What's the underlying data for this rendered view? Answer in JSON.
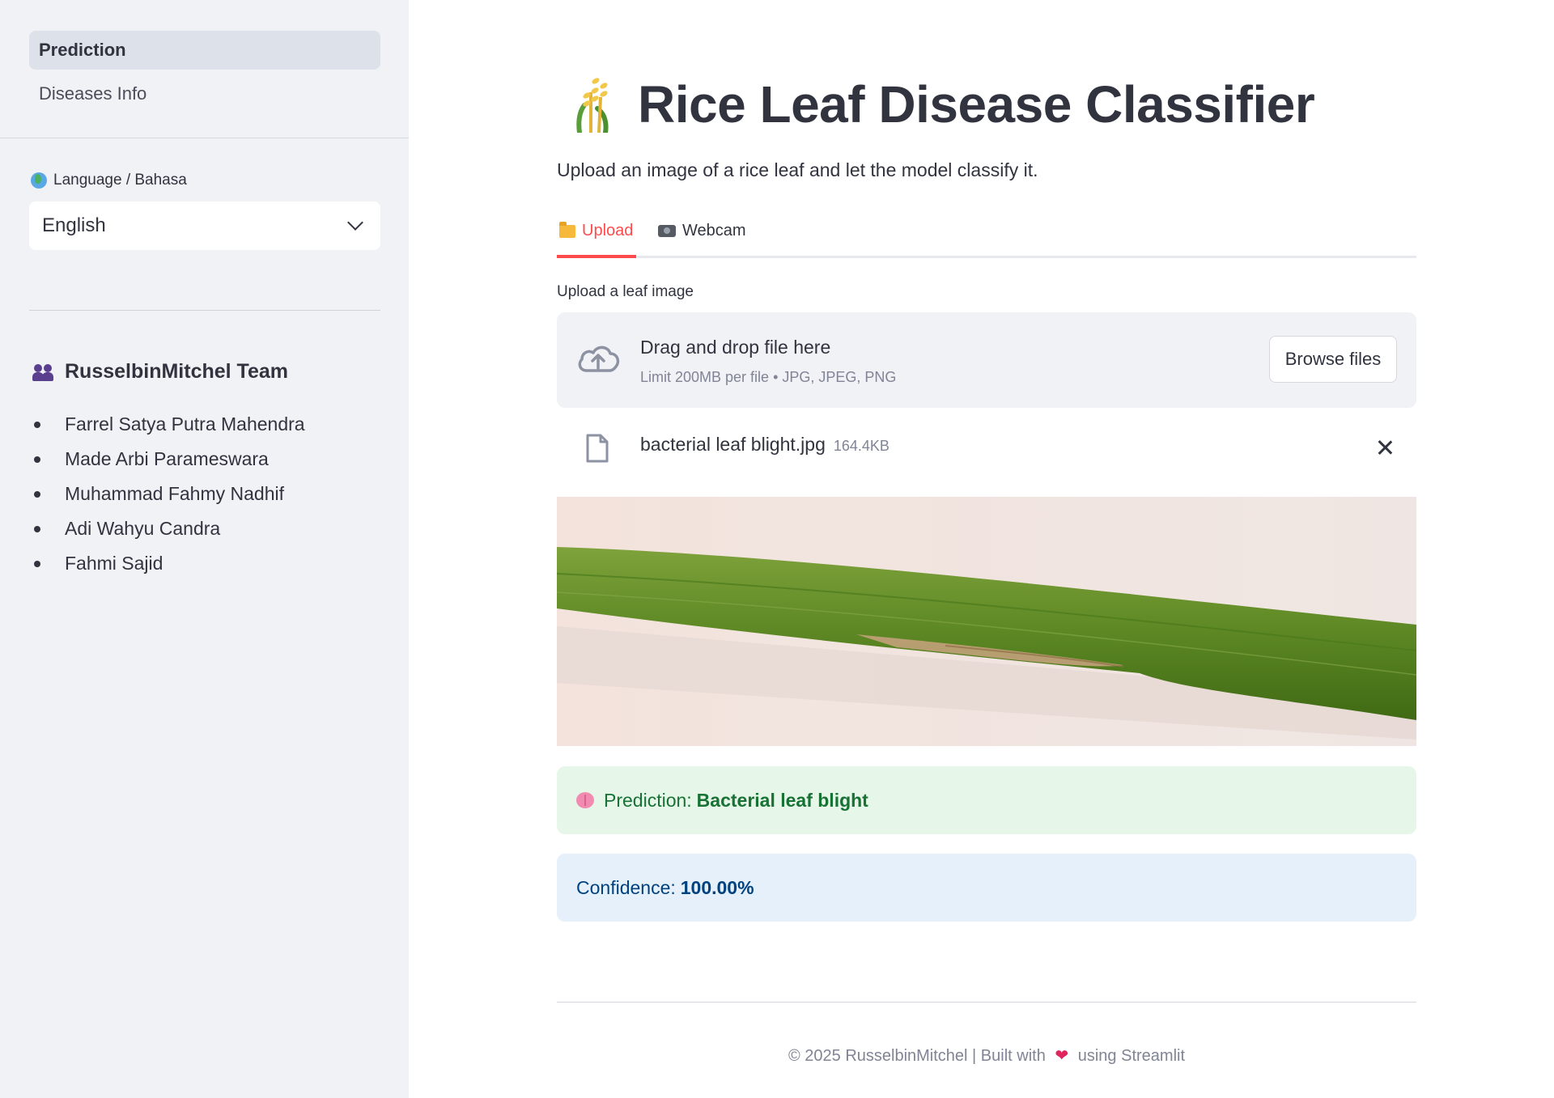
{
  "sidebar": {
    "nav": [
      {
        "label": "Prediction",
        "active": true
      },
      {
        "label": "Diseases Info",
        "active": false
      }
    ],
    "language": {
      "icon": "globe-icon",
      "label": "Language / Bahasa",
      "selected": "English"
    },
    "team": {
      "icon": "team-icon",
      "title": "RusselbinMitchel Team",
      "members": [
        "Farrel Satya Putra Mahendra",
        "Made Arbi Parameswara",
        "Muhammad Fahmy Nadhif",
        "Adi Wahyu Candra",
        "Fahmi Sajid"
      ]
    }
  },
  "main": {
    "title_icon": "rice-plant-icon",
    "title": "Rice Leaf Disease Classifier",
    "subtitle": "Upload an image of a rice leaf and let the model classify it.",
    "tabs": [
      {
        "icon": "folder-icon",
        "label": "Upload",
        "active": true
      },
      {
        "icon": "camera-icon",
        "label": "Webcam",
        "active": false
      }
    ],
    "uploader": {
      "label": "Upload a leaf image",
      "drag_text": "Drag and drop file here",
      "limit_text": "Limit 200MB per file • JPG, JPEG, PNG",
      "browse_label": "Browse files"
    },
    "file": {
      "name": "bacterial leaf blight.jpg",
      "size": "164.4KB"
    },
    "prediction": {
      "icon": "brain-icon",
      "prefix": "Prediction:",
      "value": "Bacterial leaf blight"
    },
    "confidence": {
      "prefix": "Confidence:",
      "value": "100.00%"
    },
    "footer": {
      "left": "© 2025 RusselbinMitchel | Built with",
      "heart_icon": "heart-icon",
      "right": "using Streamlit"
    }
  },
  "colors": {
    "accent": "#ff4b4b",
    "sidebar_bg": "#f0f2f6",
    "success_bg": "#e6f7ea",
    "success_text": "#177233",
    "info_bg": "#e6f0fb",
    "info_text": "#004280"
  }
}
